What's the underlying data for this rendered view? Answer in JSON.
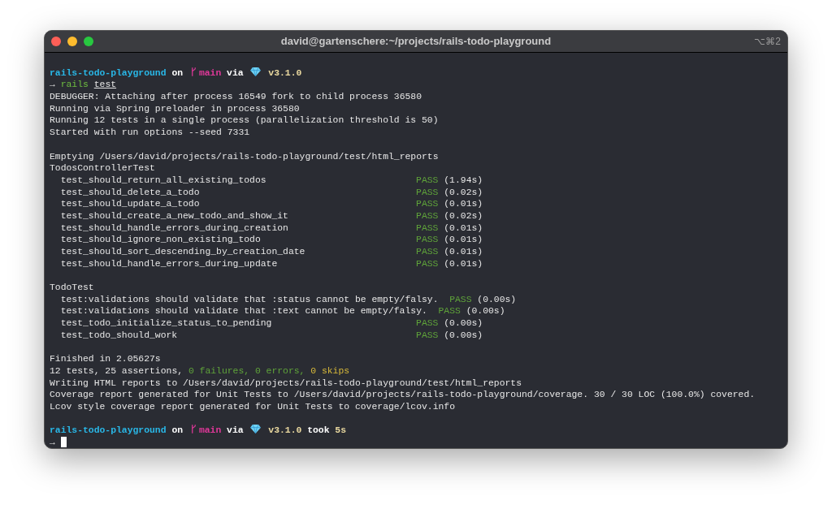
{
  "window": {
    "title": "david@gartenschere:~/projects/rails-todo-playground",
    "shortcut": "⌥⌘2"
  },
  "lines": [
    {
      "kind": "blank"
    },
    {
      "kind": "prompt",
      "dir": "rails-todo-playground",
      "on": "on",
      "branch": "main",
      "via": "via",
      "version": "v3.1.0"
    },
    {
      "kind": "command",
      "arrow": "→",
      "program": "rails",
      "args": "test"
    },
    {
      "kind": "text",
      "text": "DEBUGGER: Attaching after process 16549 fork to child process 36580"
    },
    {
      "kind": "text",
      "text": "Running via Spring preloader in process 36580"
    },
    {
      "kind": "text",
      "text": "Running 12 tests in a single process (parallelization threshold is 50)"
    },
    {
      "kind": "text",
      "text": "Started with run options --seed 7331"
    },
    {
      "kind": "blank"
    },
    {
      "kind": "text",
      "text": "Emptying /Users/david/projects/rails-todo-playground/test/html_reports"
    },
    {
      "kind": "text",
      "text": "TodosControllerTest"
    },
    {
      "kind": "result",
      "name": "test_should_return_all_existing_todos",
      "status": "PASS",
      "time": "(1.94s)"
    },
    {
      "kind": "result",
      "name": "test_should_delete_a_todo",
      "status": "PASS",
      "time": "(0.02s)"
    },
    {
      "kind": "result",
      "name": "test_should_update_a_todo",
      "status": "PASS",
      "time": "(0.01s)"
    },
    {
      "kind": "result",
      "name": "test_should_create_a_new_todo_and_show_it",
      "status": "PASS",
      "time": "(0.02s)"
    },
    {
      "kind": "result",
      "name": "test_should_handle_errors_during_creation",
      "status": "PASS",
      "time": "(0.01s)"
    },
    {
      "kind": "result",
      "name": "test_should_ignore_non_existing_todo",
      "status": "PASS",
      "time": "(0.01s)"
    },
    {
      "kind": "result",
      "name": "test_should_sort_descending_by_creation_date",
      "status": "PASS",
      "time": "(0.01s)"
    },
    {
      "kind": "result",
      "name": "test_should_handle_errors_during_update",
      "status": "PASS",
      "time": "(0.01s)"
    },
    {
      "kind": "blank"
    },
    {
      "kind": "text",
      "text": "TodoTest"
    },
    {
      "kind": "result",
      "name": "test:validations should validate that :status cannot be empty/falsy.",
      "status": "PASS",
      "time": "(0.00s)"
    },
    {
      "kind": "result",
      "name": "test:validations should validate that :text cannot be empty/falsy.",
      "status": "PASS",
      "time": "(0.00s)"
    },
    {
      "kind": "result",
      "name": "test_todo_initialize_status_to_pending",
      "status": "PASS",
      "time": "(0.00s)"
    },
    {
      "kind": "result",
      "name": "test_todo_should_work",
      "status": "PASS",
      "time": "(0.00s)"
    },
    {
      "kind": "blank"
    },
    {
      "kind": "text",
      "text": "Finished in 2.05627s"
    },
    {
      "kind": "summary",
      "segments": [
        {
          "kind": "plain",
          "text": "12 tests, 25 assertions, "
        },
        {
          "kind": "success",
          "text": "0 failures, 0 errors, "
        },
        {
          "kind": "warning",
          "text": "0 skips"
        }
      ]
    },
    {
      "kind": "text",
      "text": "Writing HTML reports to /Users/david/projects/rails-todo-playground/test/html_reports"
    },
    {
      "kind": "text",
      "text": "Coverage report generated for Unit Tests to /Users/david/projects/rails-todo-playground/coverage. 30 / 30 LOC (100.0%) covered."
    },
    {
      "kind": "text",
      "text": "Lcov style coverage report generated for Unit Tests to coverage/lcov.info"
    },
    {
      "kind": "blank"
    },
    {
      "kind": "prompt",
      "dir": "rails-todo-playground",
      "on": "on",
      "branch": "main",
      "via": "via",
      "version": "v3.1.0",
      "took": "took",
      "duration": "5s"
    },
    {
      "kind": "cursor",
      "arrow": "→"
    }
  ]
}
